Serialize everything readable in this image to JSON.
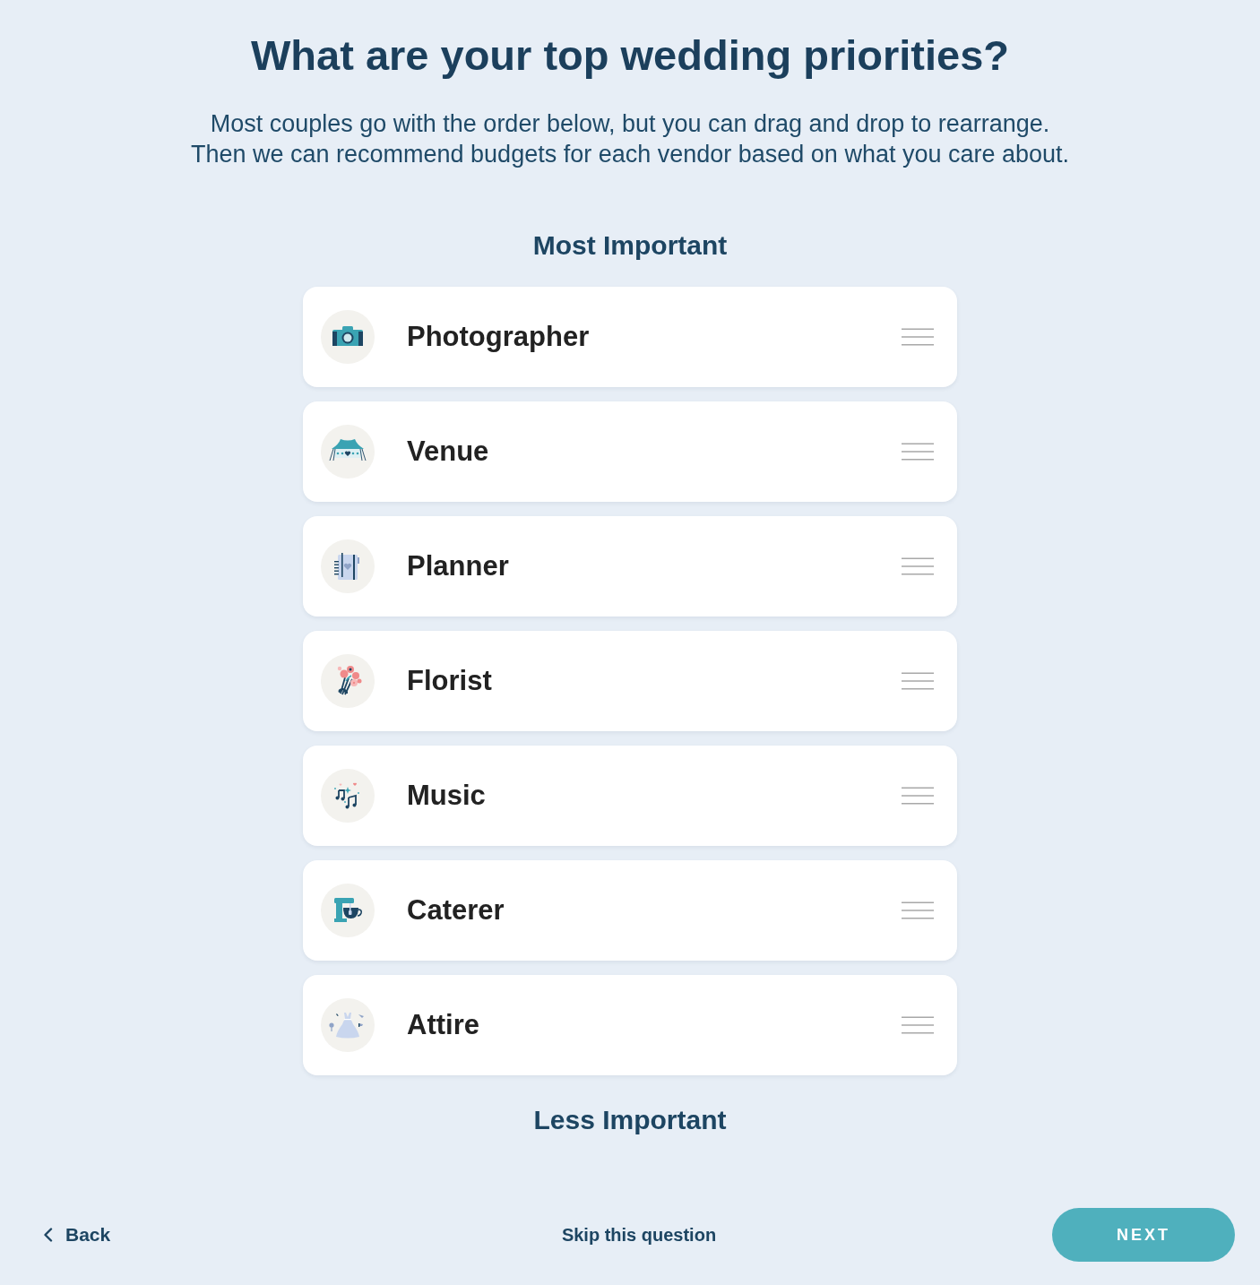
{
  "header": {
    "title": "What are your top wedding priorities?",
    "subtitle": [
      "Most couples go with the order below, but you can drag and drop to rearrange.",
      "Then we can recommend budgets for each vendor based on what you care about."
    ]
  },
  "top_label": "Most Important",
  "vendors": [
    {
      "kind": "camera",
      "label": "Photographer"
    },
    {
      "kind": "tent",
      "label": "Venue"
    },
    {
      "kind": "notebook",
      "label": "Planner"
    },
    {
      "kind": "bouquet",
      "label": "Florist"
    },
    {
      "kind": "notes",
      "label": "Music"
    },
    {
      "kind": "mixer",
      "label": "Caterer"
    },
    {
      "kind": "dress",
      "label": "Attire"
    }
  ],
  "bottom_label": "Less Important",
  "footer": {
    "back": "Back",
    "skip": "Skip this question",
    "next": "NEXT"
  }
}
